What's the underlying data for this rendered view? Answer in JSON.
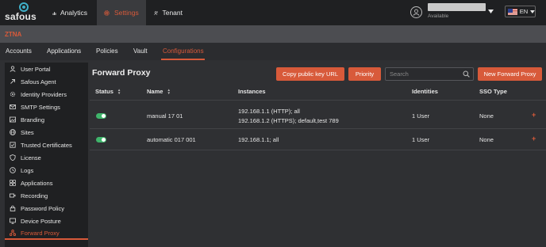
{
  "topbar": {
    "logo": "safous",
    "nav": [
      {
        "label": "Analytics",
        "icon": "bar-chart-icon"
      },
      {
        "label": "Settings",
        "icon": "gear-icon"
      },
      {
        "label": "Tenant",
        "icon": "tenant-icon"
      }
    ],
    "user_status": "Available",
    "language": "EN"
  },
  "section_label": "ZTNA",
  "tabs": [
    "Accounts",
    "Applications",
    "Policies",
    "Vault",
    "Configurations"
  ],
  "active_tab": "Configurations",
  "sidebar": {
    "items": [
      {
        "label": "User Portal",
        "icon": "user-icon"
      },
      {
        "label": "Safous Agent",
        "icon": "link-icon"
      },
      {
        "label": "Identity Providers",
        "icon": "gear-icon"
      },
      {
        "label": "SMTP Settings",
        "icon": "mail-icon"
      },
      {
        "label": "Branding",
        "icon": "image-icon"
      },
      {
        "label": "Sites",
        "icon": "globe-icon"
      },
      {
        "label": "Trusted Certificates",
        "icon": "certificate-icon"
      },
      {
        "label": "License",
        "icon": "shield-icon"
      },
      {
        "label": "Logs",
        "icon": "clock-icon"
      },
      {
        "label": "Applications",
        "icon": "grid-icon"
      },
      {
        "label": "Recording",
        "icon": "video-icon"
      },
      {
        "label": "Password Policy",
        "icon": "lock-icon"
      },
      {
        "label": "Device Posture",
        "icon": "monitor-icon"
      },
      {
        "label": "Forward Proxy",
        "icon": "proxy-icon"
      }
    ],
    "active": "Forward Proxy"
  },
  "main": {
    "title": "Forward Proxy",
    "copy_button": "Copy public key URL",
    "priority_button": "Priority",
    "search_placeholder": "Search",
    "new_button": "New Forward Proxy",
    "columns": [
      "Status",
      "Name",
      "Instances",
      "Identities",
      "SSO Type"
    ],
    "rows": [
      {
        "enabled": true,
        "name": "manual 17 01",
        "instances": [
          "192.168.1.1 (HTTP); all",
          "192.168.1.2 (HTTPS); default,test 789"
        ],
        "identities": "1 User",
        "sso_type": "None"
      },
      {
        "enabled": true,
        "name": "automatic 017 001",
        "instances": [
          "192.168.1.1; all"
        ],
        "identities": "1 User",
        "sso_type": "None"
      }
    ],
    "row_action": "+"
  },
  "colors": {
    "accent": "#d85a3a",
    "toggle_on": "#3fb56b",
    "topbar": "#1f2022",
    "background": "#2f3033"
  }
}
